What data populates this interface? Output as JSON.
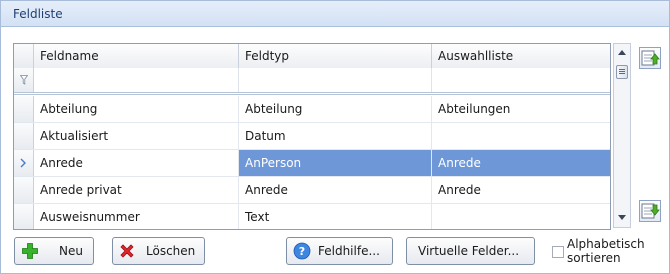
{
  "panel": {
    "title": "Feldliste"
  },
  "grid": {
    "columns": [
      "Feldname",
      "Feldtyp",
      "Auswahlliste"
    ],
    "rows": [
      {
        "feldname": "Abteilung",
        "feldtyp": "Abteilung",
        "auswahlliste": "Abteilungen",
        "selected": false
      },
      {
        "feldname": "Aktualisiert",
        "feldtyp": "Datum",
        "auswahlliste": "",
        "selected": false
      },
      {
        "feldname": "Anrede",
        "feldtyp": "AnPerson",
        "auswahlliste": "Anrede",
        "selected": true
      },
      {
        "feldname": "Anrede privat",
        "feldtyp": "Anrede",
        "auswahlliste": "Anrede",
        "selected": false
      },
      {
        "feldname": "Ausweisnummer",
        "feldtyp": "Text",
        "auswahlliste": "",
        "selected": false
      }
    ]
  },
  "buttons": {
    "new": "Neu",
    "delete": "Löschen",
    "field_help": "Feldhilfe...",
    "virtual_fields": "Virtuelle Felder..."
  },
  "sort_checkbox": {
    "label": "Alphabetisch sortieren",
    "checked": false
  },
  "icons": {
    "new": "plus-icon",
    "delete": "x-icon",
    "help": "question-icon",
    "move_up": "move-up-icon",
    "move_down": "move-down-icon"
  },
  "colors": {
    "selection": "#6e97d8",
    "header_title": "#1f3f73"
  }
}
